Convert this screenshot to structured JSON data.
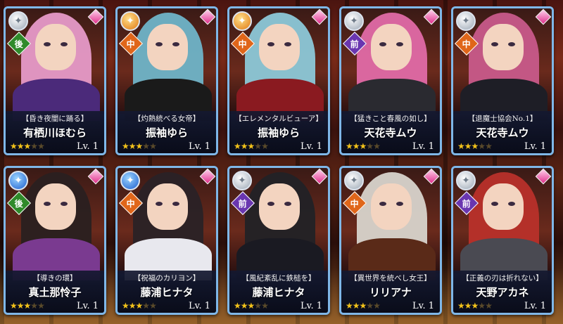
{
  "cards": [
    {
      "subtitle": "【昏き夜闇に踊る】",
      "name": "有栖川ほむら",
      "stars": 3,
      "max_stars": 5,
      "level": "Lv. 1",
      "position": "後",
      "element": "silver",
      "hair": "#e69ac8",
      "body": "#4b2a7a"
    },
    {
      "subtitle": "【灼熱統べる女帝】",
      "name": "振袖ゆら",
      "stars": 3,
      "max_stars": 5,
      "level": "Lv. 1",
      "position": "中",
      "element": "orange",
      "hair": "#6fb4c8",
      "body": "#1a1a1a"
    },
    {
      "subtitle": "【エレメンタルビューア】",
      "name": "振袖ゆら",
      "stars": 3,
      "max_stars": 5,
      "level": "Lv. 1",
      "position": "中",
      "element": "orange",
      "hair": "#8cc8d8",
      "body": "#8a1a20"
    },
    {
      "subtitle": "【猛きこと春風の如し】",
      "name": "天花寺ムウ",
      "stars": 3,
      "max_stars": 5,
      "level": "Lv. 1",
      "position": "前",
      "element": "silver",
      "hair": "#e06aa6",
      "body": "#2a2a30"
    },
    {
      "subtitle": "【退魔士協会No.1】",
      "name": "天花寺ムウ",
      "stars": 3,
      "max_stars": 5,
      "level": "Lv. 1",
      "position": "中",
      "element": "silver",
      "hair": "#c85a8a",
      "body": "#1e1e26"
    },
    {
      "subtitle": "【導きの環】",
      "name": "真土那怜子",
      "stars": 3,
      "max_stars": 5,
      "level": "Lv. 1",
      "position": "後",
      "element": "blue",
      "hair": "#2a2020",
      "body": "#7a3a90"
    },
    {
      "subtitle": "【祝福のカリヨン】",
      "name": "藤浦ヒナタ",
      "stars": 3,
      "max_stars": 5,
      "level": "Lv. 1",
      "position": "中",
      "element": "blue",
      "hair": "#2a2226",
      "body": "#e8e8ee"
    },
    {
      "subtitle": "【風紀紊乱に鉄槌を】",
      "name": "藤浦ヒナタ",
      "stars": 3,
      "max_stars": 5,
      "level": "Lv. 1",
      "position": "前",
      "element": "silver",
      "hair": "#222226",
      "body": "#1a1a22"
    },
    {
      "subtitle": "【異世界を統べし女王】",
      "name": "リリアナ",
      "stars": 3,
      "max_stars": 5,
      "level": "Lv. 1",
      "position": "中",
      "element": "silver",
      "hair": "#d8d4cc",
      "body": "#5a2a18"
    },
    {
      "subtitle": "【正義の刃は折れない】",
      "name": "天野アカネ",
      "stars": 3,
      "max_stars": 5,
      "level": "Lv. 1",
      "position": "前",
      "element": "silver",
      "hair": "#b8302a",
      "body": "#4a4a52"
    }
  ],
  "colors": {
    "card_border": "#7fb7e8",
    "star_on": "#f2c21a",
    "star_off": "#5a4a2a",
    "pos_back": "#2f8a2a",
    "pos_mid": "#e0661a",
    "pos_front": "#6a36b0",
    "gem": "#e0308c"
  },
  "icons": {
    "element": "element-orb-icon",
    "position": "position-diamond-icon",
    "rarity": "pink-gem-icon",
    "star": "star-icon"
  }
}
